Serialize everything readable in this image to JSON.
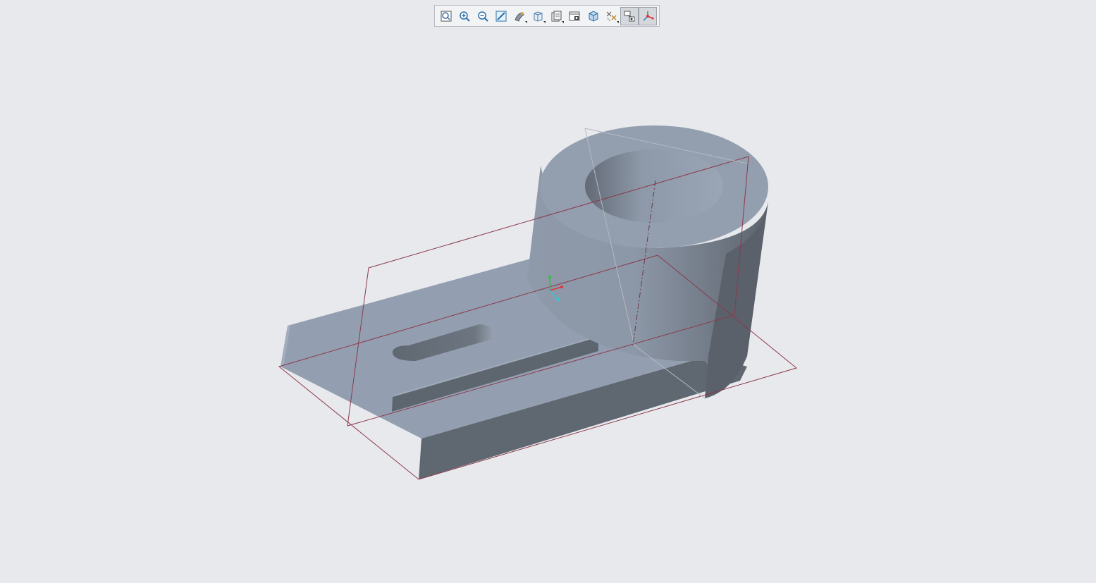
{
  "toolbar": {
    "buttons": [
      {
        "icon": "refit-icon",
        "active": false
      },
      {
        "icon": "zoom-in-icon",
        "active": false
      },
      {
        "icon": "zoom-out-icon",
        "active": false
      },
      {
        "icon": "repaint-icon",
        "active": false
      },
      {
        "icon": "display-style-icon",
        "active": false,
        "flyout": true
      },
      {
        "icon": "saved-orientations-icon",
        "active": false,
        "flyout": true
      },
      {
        "icon": "named-views-icon",
        "active": false,
        "flyout": true
      },
      {
        "icon": "view-manager-icon",
        "active": false
      },
      {
        "icon": "perspective-view-icon",
        "active": false
      },
      {
        "icon": "datum-display-filters-icon",
        "active": false,
        "flyout": true
      },
      {
        "icon": "annotation-display-icon",
        "active": true
      },
      {
        "icon": "spin-center-icon",
        "active": true
      }
    ]
  },
  "colors": {
    "background": "#e8e9ec",
    "part_light": "#94a0b1",
    "part_dark": "#5e6670",
    "datum_plane": "#8a3a4c"
  }
}
